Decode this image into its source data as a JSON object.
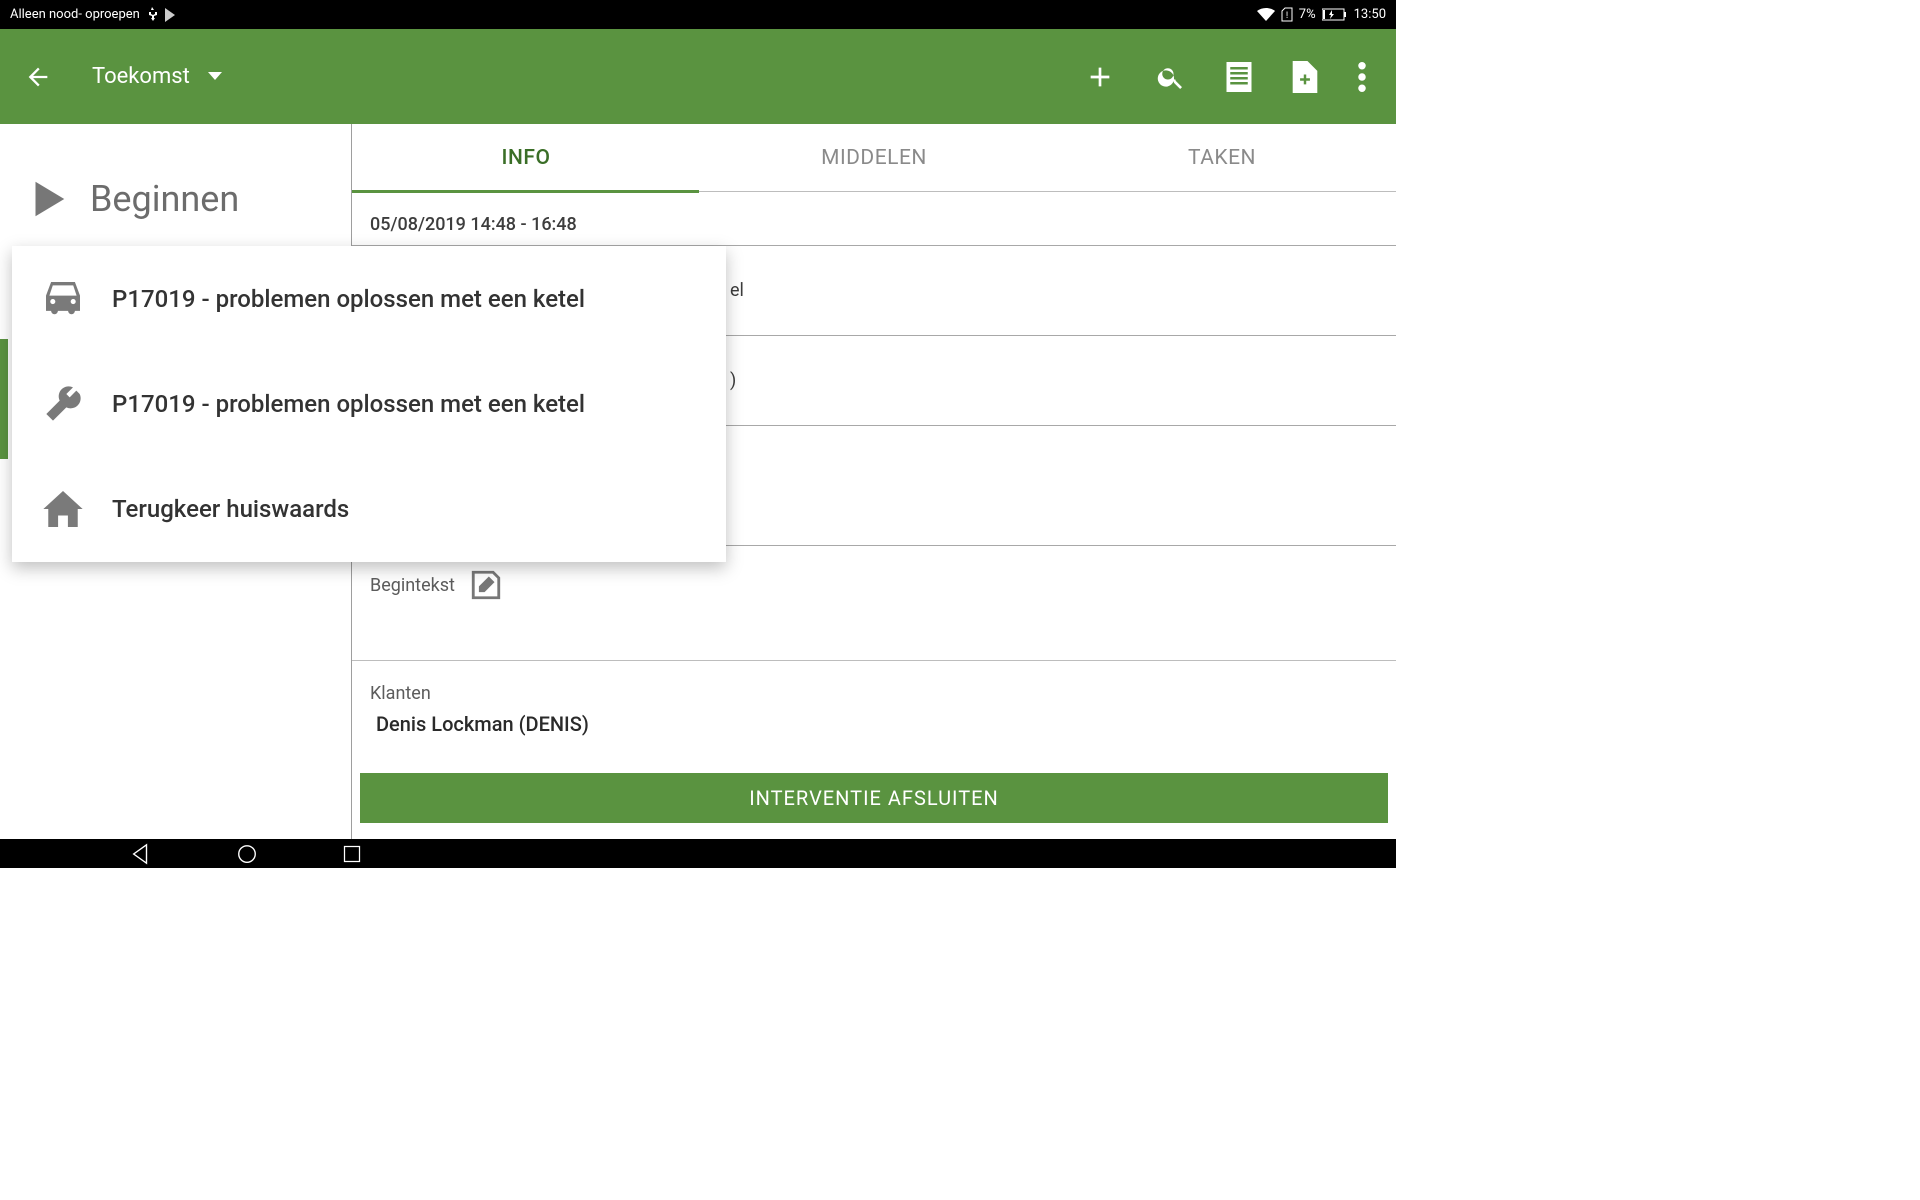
{
  "status": {
    "left_text": "Alleen nood- oproepen",
    "battery_text": "7%",
    "clock": "13:50"
  },
  "toolbar": {
    "title": "Toekomst"
  },
  "left_pane": {
    "begin_label": "Beginnen"
  },
  "tabs": {
    "info": "INFO",
    "middelen": "MIDDELEN",
    "taken": "TAKEN"
  },
  "info": {
    "datetime": "05/08/2019   14:48 - 16:48",
    "peek_text": "el",
    "peek_text_2": ")",
    "begintekst_label": "Begintekst",
    "klanten_label": "Klanten",
    "klanten_value": "Denis Lockman (DENIS)"
  },
  "popup": {
    "item1": "P17019 - problemen oplossen met een ketel",
    "item2": "P17019 - problemen oplossen met een ketel",
    "item3": "Terugkeer huiswaards"
  },
  "footer": {
    "close_label": "INTERVENTIE AFSLUITEN"
  }
}
